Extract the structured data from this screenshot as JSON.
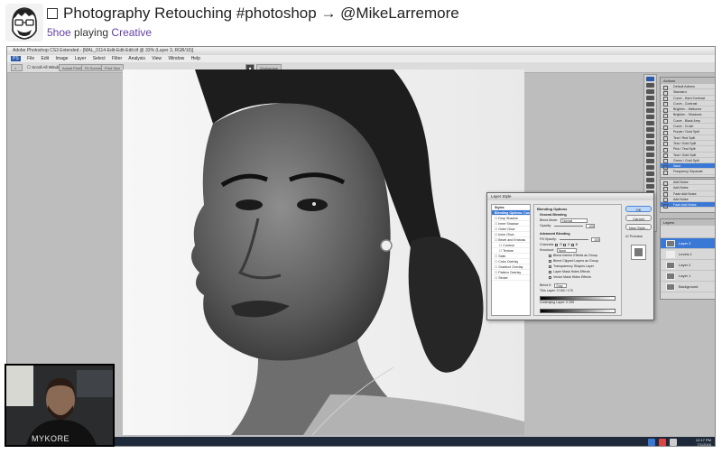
{
  "stream": {
    "title": "Photography Retouching #photoshop → @MikeLarremore",
    "streamer": "5hoe",
    "playing_word": "playing",
    "game": "Creative"
  },
  "photoshop": {
    "window_title": "Adobe Photoshop CS3 Extended - [MAL_0114-Edit-Edit-Edit.tif @ 33% (Layer 3, RGB/16)]",
    "menu": [
      "PS",
      "File",
      "Edit",
      "Image",
      "Layer",
      "Select",
      "Filter",
      "Analysis",
      "View",
      "Window",
      "Help"
    ],
    "options": {
      "scroll_all": "Scroll All Windows",
      "actual_pixels": "Actual Pixels",
      "fit_screen": "Fit Screen",
      "print_size": "Print Size",
      "workspace": "Workspace"
    },
    "actions_panel": {
      "title": "Actions",
      "items": [
        "Default Actions",
        "Standard",
        "Curve - Hard Contrast",
        "Curve - Contrast",
        "Brighten - Midtones",
        "Brighten - Shadows",
        "Curve - Black Amp",
        "Curve - Crush",
        "Purple / Gold Split",
        "Teal / Red Split",
        "Teal / Gold Split",
        "Pink / Teal Split",
        "Teal / Gold Split",
        "Green / Gold Split",
        "Save",
        "Frequency Separate"
      ],
      "selected_index": 14
    },
    "history_panel": {
      "items": [
        "Add Noise",
        "Add Noise",
        "Fade Add Noise",
        "Add Noise",
        "Fade Add Noise"
      ],
      "selected_index": 4
    },
    "layers_panel": {
      "title": "Layers",
      "layers": [
        "Layer 3",
        "Levels 1",
        "Layer 2",
        "Layer 1",
        "Background"
      ],
      "selected_index": 0
    },
    "layer_style": {
      "title": "Layer Style",
      "styles": [
        "Styles",
        "Blending Options: Custom",
        "Drop Shadow",
        "Inner Shadow",
        "Outer Glow",
        "Inner Glow",
        "Bevel and Emboss",
        "Contour",
        "Texture",
        "Satin",
        "Color Overlay",
        "Gradient Overlay",
        "Pattern Overlay",
        "Stroke"
      ],
      "selected_index": 1,
      "blending_options": "Blending Options",
      "general_blending": "General Blending",
      "blend_mode_label": "Blend Mode:",
      "blend_mode_value": "Normal",
      "opacity_label": "Opacity:",
      "opacity_value": "100",
      "advanced_blending": "Advanced Blending",
      "fill_opacity_label": "Fill Opacity:",
      "fill_opacity_value": "100",
      "channels_label": "Channels:",
      "knockout_label": "Knockout:",
      "knockout_value": "None",
      "checkboxes": [
        "Blend Interior Effects as Group",
        "Blend Clipped Layers as Group",
        "Transparency Shapes Layer",
        "Layer Mask Hides Effects",
        "Vector Mask Hides Effects"
      ],
      "blend_if_label": "Blend If:",
      "blend_if_value": "Gray",
      "this_layer_label": "This Layer:",
      "this_layer_values": "0    160 / 175",
      "underlying_label": "Underlying Layer:",
      "underlying_values": "0    255",
      "buttons": [
        "OK",
        "Cancel",
        "New Style...",
        "Preview"
      ]
    },
    "clock": {
      "time": "12:17 PM",
      "date": "7/1/2016"
    }
  },
  "webcam": {
    "overlay_text": "MYKORE"
  },
  "colors": {
    "accent": "#6441a5",
    "selection": "#3a78d6"
  }
}
